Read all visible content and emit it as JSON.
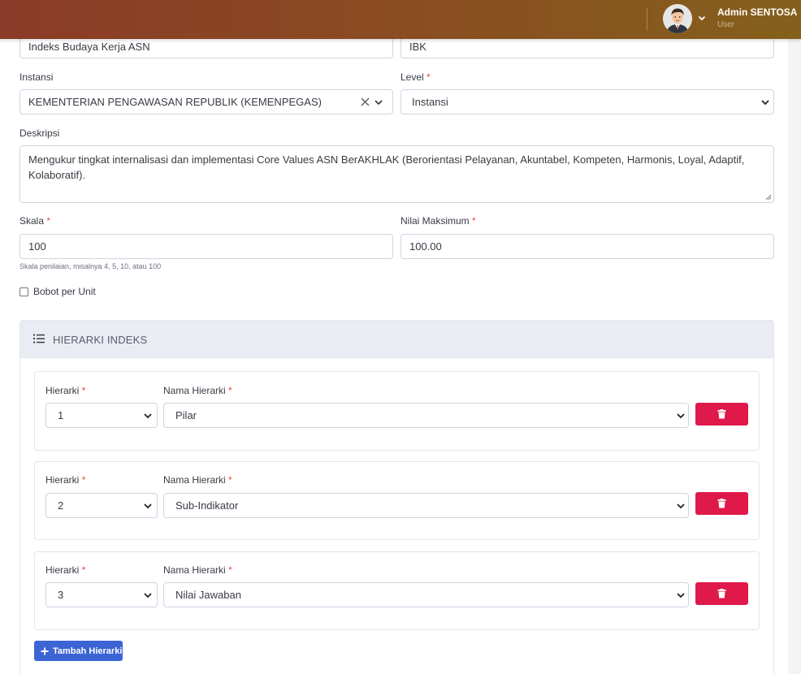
{
  "user": {
    "name": "Admin SENTOSA",
    "role": "User"
  },
  "form": {
    "name_value": "Indeks Budaya Kerja ASN",
    "code_value": "IBK",
    "instansi": {
      "label": "Instansi",
      "value": "KEMENTERIAN PENGAWASAN REPUBLIK (KEMENPEGAS)"
    },
    "level": {
      "label": "Level",
      "value": "Instansi"
    },
    "deskripsi": {
      "label": "Deskripsi",
      "value": "Mengukur tingkat internalisasi dan implementasi Core Values ASN BerAKHLAK (Berorientasi Pelayanan, Akuntabel, Kompeten, Harmonis, Loyal, Adaptif, Kolaboratif)."
    },
    "skala": {
      "label": "Skala",
      "value": "100",
      "help": "Skala penilaian, misalnya 4, 5, 10, atau 100"
    },
    "nilai_maksimum": {
      "label": "Nilai Maksimum",
      "value": "100.00"
    },
    "bobot_per_unit": {
      "label": "Bobot per Unit",
      "checked": false
    },
    "required_mark": "*"
  },
  "hierarki": {
    "title": "HIERARKI INDEKS",
    "level_label": "Hierarki",
    "name_label": "Nama Hierarki",
    "rows": [
      {
        "level": "1",
        "name": "Pilar"
      },
      {
        "level": "2",
        "name": "Sub-Indikator"
      },
      {
        "level": "3",
        "name": "Nilai Jawaban"
      }
    ],
    "add_label": "Tambah Hierarki"
  },
  "icons": {
    "clear": "close-icon",
    "dropdown": "chevron-down-icon",
    "delete": "trash-icon",
    "add": "plus-icon",
    "list": "list-icon"
  },
  "colors": {
    "danger": "#e0194b",
    "primary": "#3b64d4",
    "required": "#e74a3b"
  }
}
